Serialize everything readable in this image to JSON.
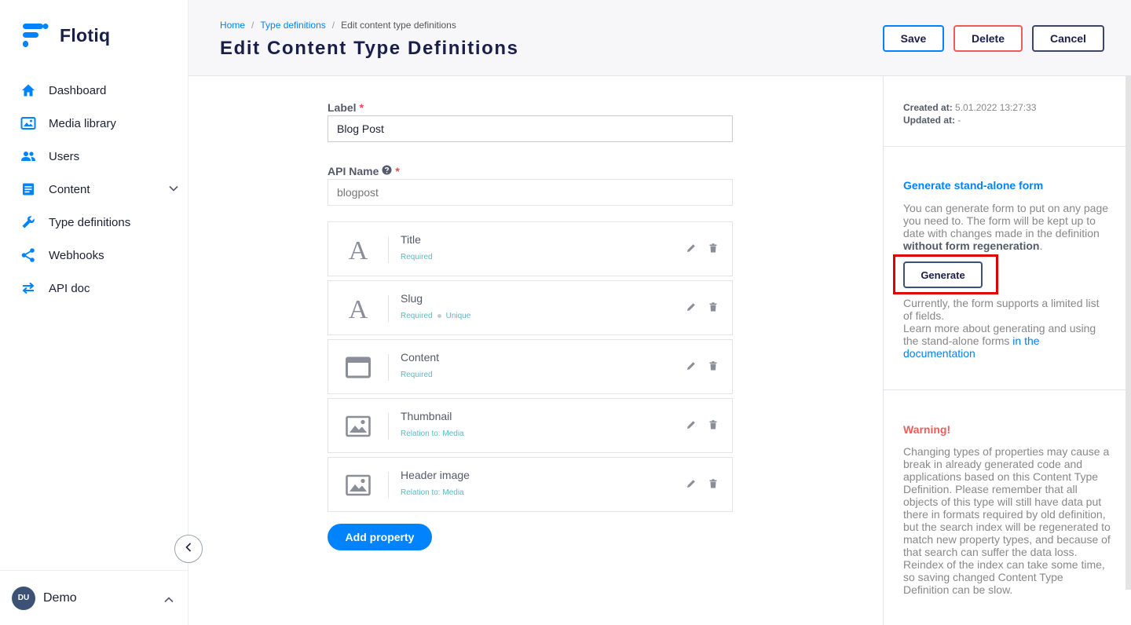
{
  "app": {
    "name": "Flotiq"
  },
  "sidebar": {
    "items": [
      {
        "label": "Dashboard",
        "icon": "home-icon"
      },
      {
        "label": "Media library",
        "icon": "image-gallery-icon"
      },
      {
        "label": "Users",
        "icon": "users-icon"
      },
      {
        "label": "Content",
        "icon": "document-icon"
      },
      {
        "label": "Type definitions",
        "icon": "wrench-icon"
      },
      {
        "label": "Webhooks",
        "icon": "share-icon"
      },
      {
        "label": "API doc",
        "icon": "swap-arrows-icon"
      }
    ],
    "user": {
      "initials": "DU",
      "name": "Demo"
    }
  },
  "header": {
    "breadcrumb": [
      "Home",
      "Type definitions",
      "Edit content type definitions"
    ],
    "title": "Edit Content Type Definitions",
    "buttons": {
      "save": "Save",
      "delete": "Delete",
      "cancel": "Cancel"
    }
  },
  "form": {
    "label": {
      "title": "Label",
      "required": "*",
      "value": "Blog Post"
    },
    "api_name": {
      "title": "API Name",
      "required": "*",
      "placeholder": "blogpost"
    },
    "properties": [
      {
        "name": "Title",
        "meta": [
          "Required"
        ],
        "icon": "text-icon"
      },
      {
        "name": "Slug",
        "meta": [
          "Required",
          "Unique"
        ],
        "icon": "text-icon"
      },
      {
        "name": "Content",
        "meta": [
          "Required"
        ],
        "icon": "richtext-window-icon"
      },
      {
        "name": "Thumbnail",
        "meta": [
          "Relation to: Media"
        ],
        "icon": "image-icon"
      },
      {
        "name": "Header image",
        "meta": [
          "Relation to: Media"
        ],
        "icon": "image-icon"
      }
    ],
    "add_property": "Add property"
  },
  "right_panel": {
    "created_label": "Created at:",
    "created_value": "5.01.2022 13:27:33",
    "updated_label": "Updated at:",
    "updated_value": "-",
    "standalone": {
      "title": "Generate stand-alone form",
      "desc_pre": "You can generate form to put on any page you need to. The form will be kept up to date with changes made in the definition ",
      "desc_bold": "without form regeneration",
      "desc_post": ".",
      "button": "Generate",
      "note_1": "Currently, the form supports a limited list of fields.",
      "note_2": "Learn more about generating and using the stand-alone forms ",
      "link": "in the documentation"
    },
    "warning": {
      "title": "Warning!",
      "text": "Changing types of properties may cause a break in already generated code and applications based on this Content Type Definition. Please remember that all objects of this type will still have data put there in formats required by old definition, but the search index will be regenerated to match new property types, and because of that search can suffer the data loss. Reindex of the index can take some time, so saving changed Content Type Definition can be slow."
    }
  },
  "colors": {
    "accent": "#0083fc",
    "danger": "#ef5b5b",
    "navy": "#1a1f4a",
    "highlight": "#e10000"
  }
}
